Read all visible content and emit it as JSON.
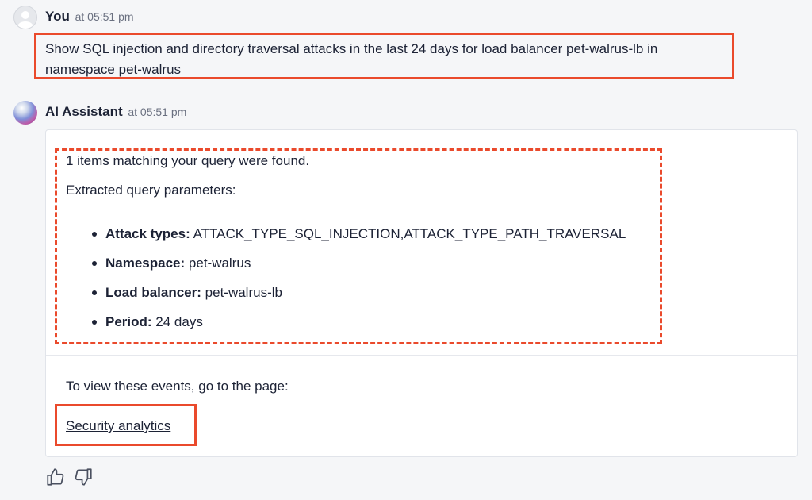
{
  "user_message": {
    "author": "You",
    "time": "at 05:51 pm",
    "text": "Show SQL injection and directory traversal attacks in the last 24 days for load balancer pet-walrus-lb in namespace pet-walrus"
  },
  "assistant_message": {
    "author": "AI Assistant",
    "time": "at 05:51 pm",
    "found_text": "1 items matching your query were found.",
    "extracted_label": "Extracted query parameters:",
    "params": [
      {
        "key": "Attack types:",
        "value": "ATTACK_TYPE_SQL_INJECTION,ATTACK_TYPE_PATH_TRAVERSAL"
      },
      {
        "key": "Namespace:",
        "value": "pet-walrus"
      },
      {
        "key": "Load balancer:",
        "value": "pet-walrus-lb"
      },
      {
        "key": "Period:",
        "value": "24 days"
      }
    ],
    "view_text": "To view these events, go to the page:",
    "link_label": "Security analytics"
  },
  "feedback": {
    "like_icon": "thumbs-up-icon",
    "dislike_icon": "thumbs-down-icon"
  },
  "colors": {
    "highlight": "#ea4a2c",
    "text": "#1c2235",
    "background": "#f5f6f8"
  }
}
